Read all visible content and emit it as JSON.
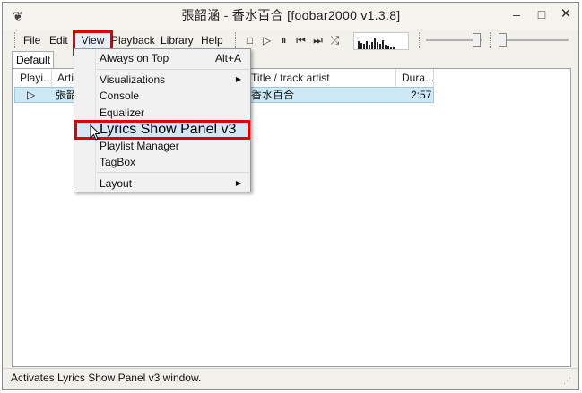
{
  "window": {
    "title": "張韶涵 - 香水百合  [foobar2000 v1.3.8]",
    "icon": "foobar-icon",
    "buttons": {
      "minimize": "–",
      "maximize": "□",
      "close": "✕"
    }
  },
  "menubar": {
    "file": "File",
    "edit": "Edit",
    "view": "View",
    "playback": "Playback",
    "library": "Library",
    "help": "Help"
  },
  "toolbar": {
    "stop": "□",
    "play": "▷",
    "pause": "⏸",
    "prev": "⏮",
    "next": "⏭",
    "random": "⤮"
  },
  "tabs": [
    "Default"
  ],
  "playlist": {
    "columns": [
      "Playi...",
      "Artis",
      "Title / track artist",
      "Dura..."
    ],
    "rows": [
      {
        "playing": "▷",
        "artist": "張韶",
        "title": "香水百合",
        "duration": "2:57"
      }
    ]
  },
  "view_menu": {
    "always_on_top": "Always on Top",
    "always_on_top_shortcut": "Alt+A",
    "visualizations": "Visualizations",
    "console": "Console",
    "equalizer": "Equalizer",
    "lyrics_show_panel": "Lyrics Show Panel v3",
    "playlist_manager": "Playlist Manager",
    "tagbox": "TagBox",
    "layout": "Layout",
    "submenu_arrow": "▶"
  },
  "status": {
    "text": "Activates Lyrics Show Panel v3 window."
  },
  "colors": {
    "highlight": "#e10000",
    "selection": "#cde8f7",
    "menu_hover": "#d5e6f6"
  }
}
